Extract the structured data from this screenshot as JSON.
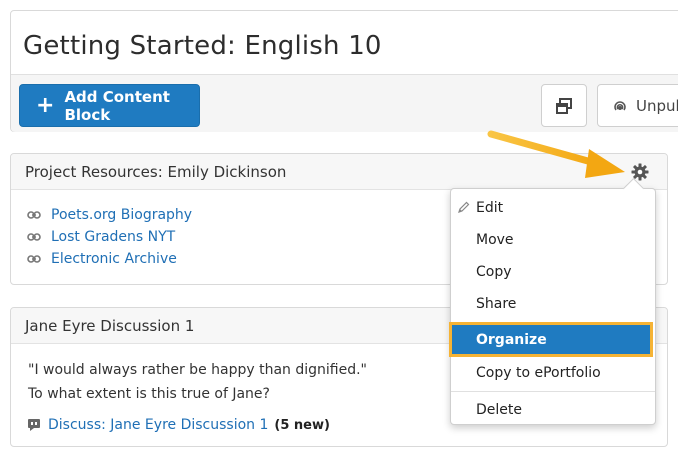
{
  "page": {
    "title": "Getting Started: English 10"
  },
  "toolbar": {
    "add_label": "Add Content Block",
    "unpublish_label": "Unpub"
  },
  "block1": {
    "title": "Project Resources: Emily Dickinson",
    "links": [
      "Poets.org Biography",
      "Lost Gradens NYT",
      "Electronic Archive"
    ]
  },
  "block2": {
    "title": "Jane Eyre Discussion 1",
    "quote": "\"I would always rather be happy than dignified.\"",
    "question": "To what extent is this true of Jane?",
    "discussion_link": "Discuss: Jane Eyre Discussion 1",
    "discussion_new": "(5 new)"
  },
  "menu": {
    "items": [
      "Edit",
      "Move",
      "Copy",
      "Share",
      "Organize",
      "Copy to ePortfolio",
      "Delete"
    ],
    "highlighted": "Organize"
  },
  "icons": {
    "add": "plus-icon",
    "windows": "duplicate-windows-icon",
    "unpublish": "broadcast-icon",
    "link": "link-icon",
    "gear": "gear-icon",
    "edit": "pencil-icon",
    "discussion": "speech-bubble-icon",
    "annotation": "arrow-icon"
  },
  "colors": {
    "accent_blue": "#1f7bc1",
    "link_blue": "#1f6fb5",
    "highlight_orange": "#f5b335"
  }
}
